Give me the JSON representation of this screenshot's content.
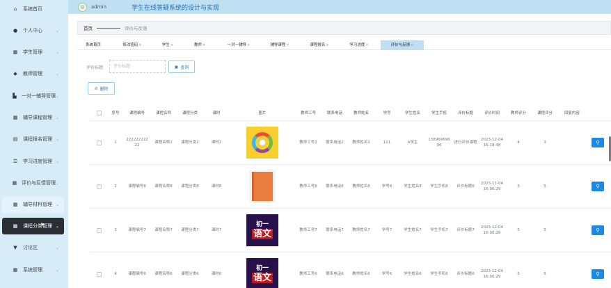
{
  "header": {
    "avatar_icon": "user-avatar-icon",
    "username": "admin",
    "system_title": "学生在线答疑系统的设计与实现"
  },
  "sidebar": {
    "items": [
      {
        "label": "系统首页",
        "icon": "home-icon",
        "has_children": false
      },
      {
        "label": "个人中心",
        "icon": "person-icon",
        "has_children": true
      },
      {
        "label": "学生管理",
        "icon": "grid-icon",
        "has_children": true
      },
      {
        "label": "教师管理",
        "icon": "location-icon",
        "has_children": true
      },
      {
        "label": "一对一辅导管理",
        "icon": "chart-icon",
        "has_children": true
      },
      {
        "label": "辅导课程管理",
        "icon": "grid-icon",
        "has_children": true
      },
      {
        "label": "课程报名管理",
        "icon": "document-icon",
        "has_children": true
      },
      {
        "label": "学习进度管理",
        "icon": "sliders-icon",
        "has_children": true
      },
      {
        "label": "评价与反馈管理",
        "icon": "table-icon",
        "has_children": true
      },
      {
        "label": "辅导材料管理",
        "icon": "grid-icon",
        "has_children": true
      },
      {
        "label": "课程分类管理",
        "icon": "grid-icon",
        "has_children": true
      },
      {
        "label": "讨论区",
        "icon": "forum-icon",
        "has_children": true
      },
      {
        "label": "系统管理",
        "icon": "grid-icon",
        "has_children": true
      }
    ],
    "active_item": "课程分类管理"
  },
  "breadcrumb": {
    "home": "首页",
    "current": "评价与反馈"
  },
  "tabs": [
    {
      "label": "系统首页",
      "closable": false
    },
    {
      "label": "修改密码",
      "closable": true
    },
    {
      "label": "学生",
      "closable": true
    },
    {
      "label": "教师",
      "closable": true
    },
    {
      "label": "一对一辅导",
      "closable": true
    },
    {
      "label": "辅导课程",
      "closable": true
    },
    {
      "label": "课程报名",
      "closable": true
    },
    {
      "label": "学习进度",
      "closable": true
    },
    {
      "label": "评价与反馈",
      "closable": true,
      "active": true
    }
  ],
  "search": {
    "label": "评价标题",
    "placeholder": "评价标题",
    "query_button": "查询"
  },
  "actions": {
    "delete_button": "删除"
  },
  "table": {
    "columns": [
      "序号",
      "课程编号",
      "课程名称",
      "课程分类",
      "课时",
      "图片",
      "教师工号",
      "联系电话",
      "教师姓名",
      "学号",
      "学生姓名",
      "学生手机",
      "评价标题",
      "评价时间",
      "教师评分",
      "课程评分",
      "回复内容"
    ],
    "rows": [
      {
        "index": "1",
        "course_no": "22222222222",
        "course_name": "课程名称2",
        "category": "课程分类2",
        "hours": "课时2",
        "image": "colorful-wheel-image",
        "teacher_no": "教师工号2",
        "phone": "联系电话2",
        "teacher_name": "教师姓名2",
        "student_no": "111",
        "student_name": "A学生",
        "student_phone": "13896969696",
        "title": "进行评价课程",
        "time": "2023-12-04 16:18:48",
        "teacher_score": "4",
        "course_score": "3",
        "reply": ""
      },
      {
        "index": "2",
        "course_no": "课程编号8",
        "course_name": "课程名称8",
        "category": "课程分类8",
        "hours": "课时8",
        "image": "orange-book-image",
        "teacher_no": "教师工号8",
        "phone": "联系电话8",
        "teacher_name": "教师姓名8",
        "student_no": "学号8",
        "student_name": "学生姓名8",
        "student_phone": "学生手机8",
        "title": "评价标题8",
        "time": "2023-12-04 16:06:29",
        "teacher_score": "5",
        "course_score": "5",
        "reply": ""
      },
      {
        "index": "3",
        "course_no": "课程编号7",
        "course_name": "课程名称7",
        "category": "课程分类7",
        "hours": "课时7",
        "image": "chinese-textbook-image",
        "teacher_no": "教师工号7",
        "phone": "联系电话7",
        "teacher_name": "教师姓名7",
        "student_no": "学号7",
        "student_name": "学生姓名7",
        "student_phone": "学生手机7",
        "title": "评价标题7",
        "time": "2023-12-04 16:06:29",
        "teacher_score": "5",
        "course_score": "5",
        "reply": ""
      },
      {
        "index": "4",
        "course_no": "课程编号6",
        "course_name": "课程名称6",
        "category": "课程分类6",
        "hours": "课时6",
        "image": "chinese-textbook-image",
        "teacher_no": "教师工号6",
        "phone": "联系电话6",
        "teacher_name": "教师姓名6",
        "student_no": "学号6",
        "student_name": "学生姓名6",
        "student_phone": "学生手机6",
        "title": "评价标题6",
        "time": "2023-12-04 16:06:29",
        "teacher_score": "5",
        "course_score": "5",
        "reply": ""
      }
    ],
    "image_text": {
      "line1": "初一",
      "line2": "语文"
    }
  },
  "colors": {
    "sidebar_bg": "#d8ecf7",
    "header_bg": "#bfe0f2",
    "active_menu_bg": "#2b2f33",
    "title_blue": "#1d6fb8",
    "action_blue": "#1e88e5"
  }
}
